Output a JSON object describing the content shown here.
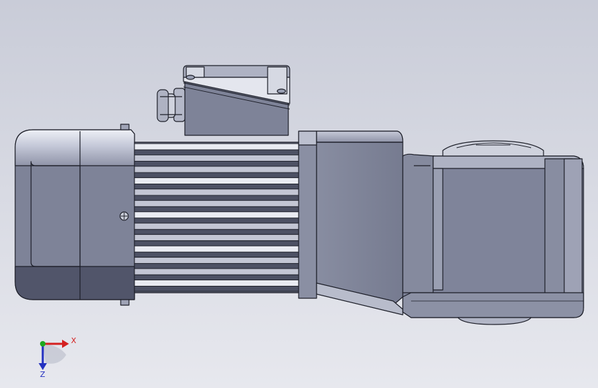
{
  "viewport": {
    "background_top": "#c9ccd8",
    "background_bottom": "#e7e8ee"
  },
  "model": {
    "body_color": "#7e8398",
    "body_dark": "#4d5164",
    "body_light": "#aeb2c3",
    "highlight": "#e9ebf2",
    "edge_color": "#1d1f29",
    "fin_count": 13
  },
  "triad": {
    "x_label": "X",
    "z_label": "Z",
    "x_color": "#d42020",
    "y_color": "#1fa81f",
    "z_color": "#2330c0"
  }
}
